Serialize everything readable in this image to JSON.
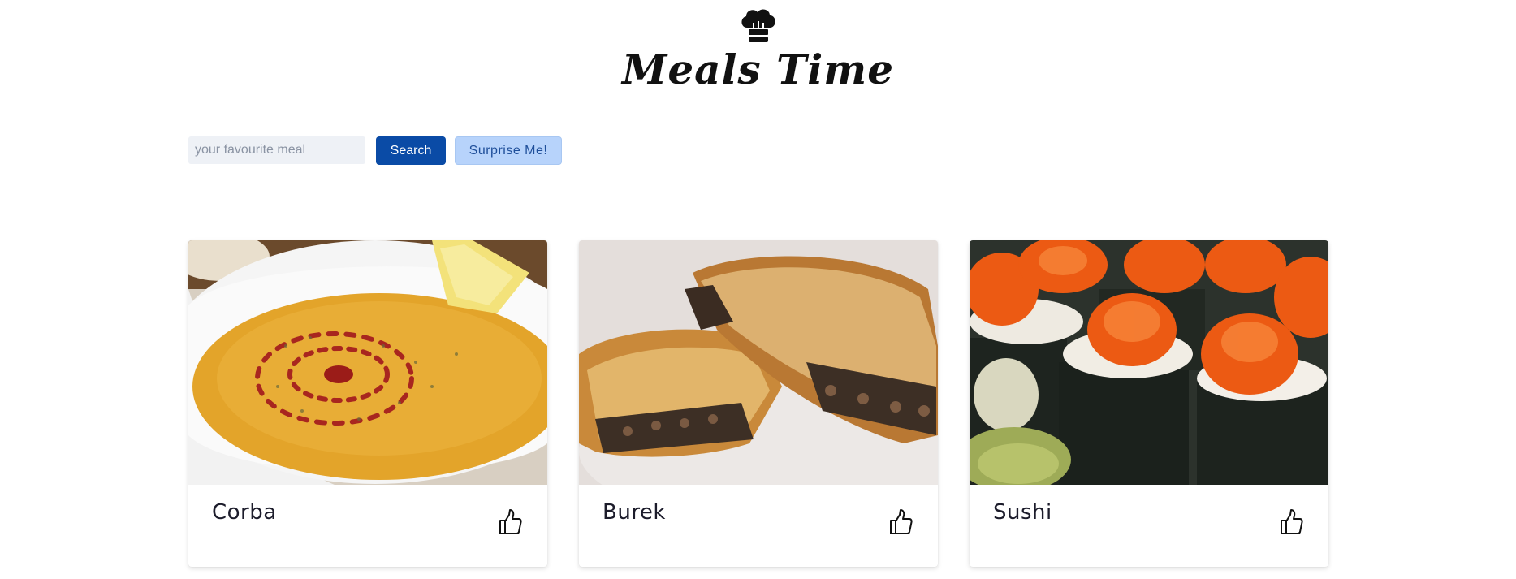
{
  "header": {
    "logo_icon": "chef-hat-icon",
    "brand_title": "Meals Time"
  },
  "search": {
    "placeholder": "your favourite meal",
    "value": "",
    "search_button_label": "Search",
    "surprise_button_label": "Surprise Me!"
  },
  "meals": [
    {
      "name": "Corba",
      "image": "lentil-soup-photo",
      "like_icon": "thumbs-up-icon"
    },
    {
      "name": "Burek",
      "image": "burek-pastry-photo",
      "like_icon": "thumbs-up-icon"
    },
    {
      "name": "Sushi",
      "image": "sushi-rolls-photo",
      "like_icon": "thumbs-up-icon"
    }
  ],
  "colors": {
    "search_button": "#0a4ba6",
    "surprise_button": "#b7d3fb",
    "input_background": "#eef1f6"
  }
}
